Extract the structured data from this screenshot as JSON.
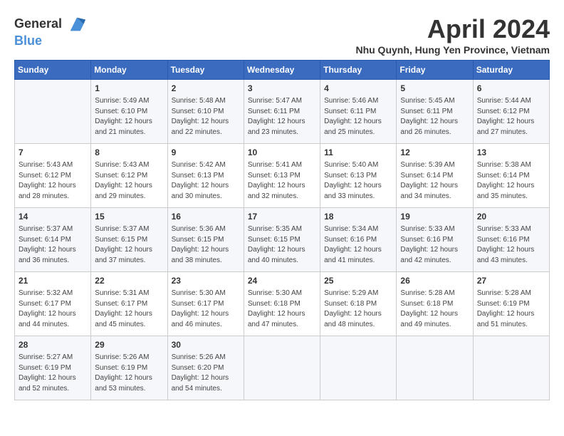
{
  "header": {
    "logo_line1": "General",
    "logo_line2": "Blue",
    "month_year": "April 2024",
    "location": "Nhu Quynh, Hung Yen Province, Vietnam"
  },
  "weekdays": [
    "Sunday",
    "Monday",
    "Tuesday",
    "Wednesday",
    "Thursday",
    "Friday",
    "Saturday"
  ],
  "weeks": [
    [
      {
        "day": "",
        "info": ""
      },
      {
        "day": "1",
        "info": "Sunrise: 5:49 AM\nSunset: 6:10 PM\nDaylight: 12 hours\nand 21 minutes."
      },
      {
        "day": "2",
        "info": "Sunrise: 5:48 AM\nSunset: 6:10 PM\nDaylight: 12 hours\nand 22 minutes."
      },
      {
        "day": "3",
        "info": "Sunrise: 5:47 AM\nSunset: 6:11 PM\nDaylight: 12 hours\nand 23 minutes."
      },
      {
        "day": "4",
        "info": "Sunrise: 5:46 AM\nSunset: 6:11 PM\nDaylight: 12 hours\nand 25 minutes."
      },
      {
        "day": "5",
        "info": "Sunrise: 5:45 AM\nSunset: 6:11 PM\nDaylight: 12 hours\nand 26 minutes."
      },
      {
        "day": "6",
        "info": "Sunrise: 5:44 AM\nSunset: 6:12 PM\nDaylight: 12 hours\nand 27 minutes."
      }
    ],
    [
      {
        "day": "7",
        "info": "Sunrise: 5:43 AM\nSunset: 6:12 PM\nDaylight: 12 hours\nand 28 minutes."
      },
      {
        "day": "8",
        "info": "Sunrise: 5:43 AM\nSunset: 6:12 PM\nDaylight: 12 hours\nand 29 minutes."
      },
      {
        "day": "9",
        "info": "Sunrise: 5:42 AM\nSunset: 6:13 PM\nDaylight: 12 hours\nand 30 minutes."
      },
      {
        "day": "10",
        "info": "Sunrise: 5:41 AM\nSunset: 6:13 PM\nDaylight: 12 hours\nand 32 minutes."
      },
      {
        "day": "11",
        "info": "Sunrise: 5:40 AM\nSunset: 6:13 PM\nDaylight: 12 hours\nand 33 minutes."
      },
      {
        "day": "12",
        "info": "Sunrise: 5:39 AM\nSunset: 6:14 PM\nDaylight: 12 hours\nand 34 minutes."
      },
      {
        "day": "13",
        "info": "Sunrise: 5:38 AM\nSunset: 6:14 PM\nDaylight: 12 hours\nand 35 minutes."
      }
    ],
    [
      {
        "day": "14",
        "info": "Sunrise: 5:37 AM\nSunset: 6:14 PM\nDaylight: 12 hours\nand 36 minutes."
      },
      {
        "day": "15",
        "info": "Sunrise: 5:37 AM\nSunset: 6:15 PM\nDaylight: 12 hours\nand 37 minutes."
      },
      {
        "day": "16",
        "info": "Sunrise: 5:36 AM\nSunset: 6:15 PM\nDaylight: 12 hours\nand 38 minutes."
      },
      {
        "day": "17",
        "info": "Sunrise: 5:35 AM\nSunset: 6:15 PM\nDaylight: 12 hours\nand 40 minutes."
      },
      {
        "day": "18",
        "info": "Sunrise: 5:34 AM\nSunset: 6:16 PM\nDaylight: 12 hours\nand 41 minutes."
      },
      {
        "day": "19",
        "info": "Sunrise: 5:33 AM\nSunset: 6:16 PM\nDaylight: 12 hours\nand 42 minutes."
      },
      {
        "day": "20",
        "info": "Sunrise: 5:33 AM\nSunset: 6:16 PM\nDaylight: 12 hours\nand 43 minutes."
      }
    ],
    [
      {
        "day": "21",
        "info": "Sunrise: 5:32 AM\nSunset: 6:17 PM\nDaylight: 12 hours\nand 44 minutes."
      },
      {
        "day": "22",
        "info": "Sunrise: 5:31 AM\nSunset: 6:17 PM\nDaylight: 12 hours\nand 45 minutes."
      },
      {
        "day": "23",
        "info": "Sunrise: 5:30 AM\nSunset: 6:17 PM\nDaylight: 12 hours\nand 46 minutes."
      },
      {
        "day": "24",
        "info": "Sunrise: 5:30 AM\nSunset: 6:18 PM\nDaylight: 12 hours\nand 47 minutes."
      },
      {
        "day": "25",
        "info": "Sunrise: 5:29 AM\nSunset: 6:18 PM\nDaylight: 12 hours\nand 48 minutes."
      },
      {
        "day": "26",
        "info": "Sunrise: 5:28 AM\nSunset: 6:18 PM\nDaylight: 12 hours\nand 49 minutes."
      },
      {
        "day": "27",
        "info": "Sunrise: 5:28 AM\nSunset: 6:19 PM\nDaylight: 12 hours\nand 51 minutes."
      }
    ],
    [
      {
        "day": "28",
        "info": "Sunrise: 5:27 AM\nSunset: 6:19 PM\nDaylight: 12 hours\nand 52 minutes."
      },
      {
        "day": "29",
        "info": "Sunrise: 5:26 AM\nSunset: 6:19 PM\nDaylight: 12 hours\nand 53 minutes."
      },
      {
        "day": "30",
        "info": "Sunrise: 5:26 AM\nSunset: 6:20 PM\nDaylight: 12 hours\nand 54 minutes."
      },
      {
        "day": "",
        "info": ""
      },
      {
        "day": "",
        "info": ""
      },
      {
        "day": "",
        "info": ""
      },
      {
        "day": "",
        "info": ""
      }
    ]
  ]
}
